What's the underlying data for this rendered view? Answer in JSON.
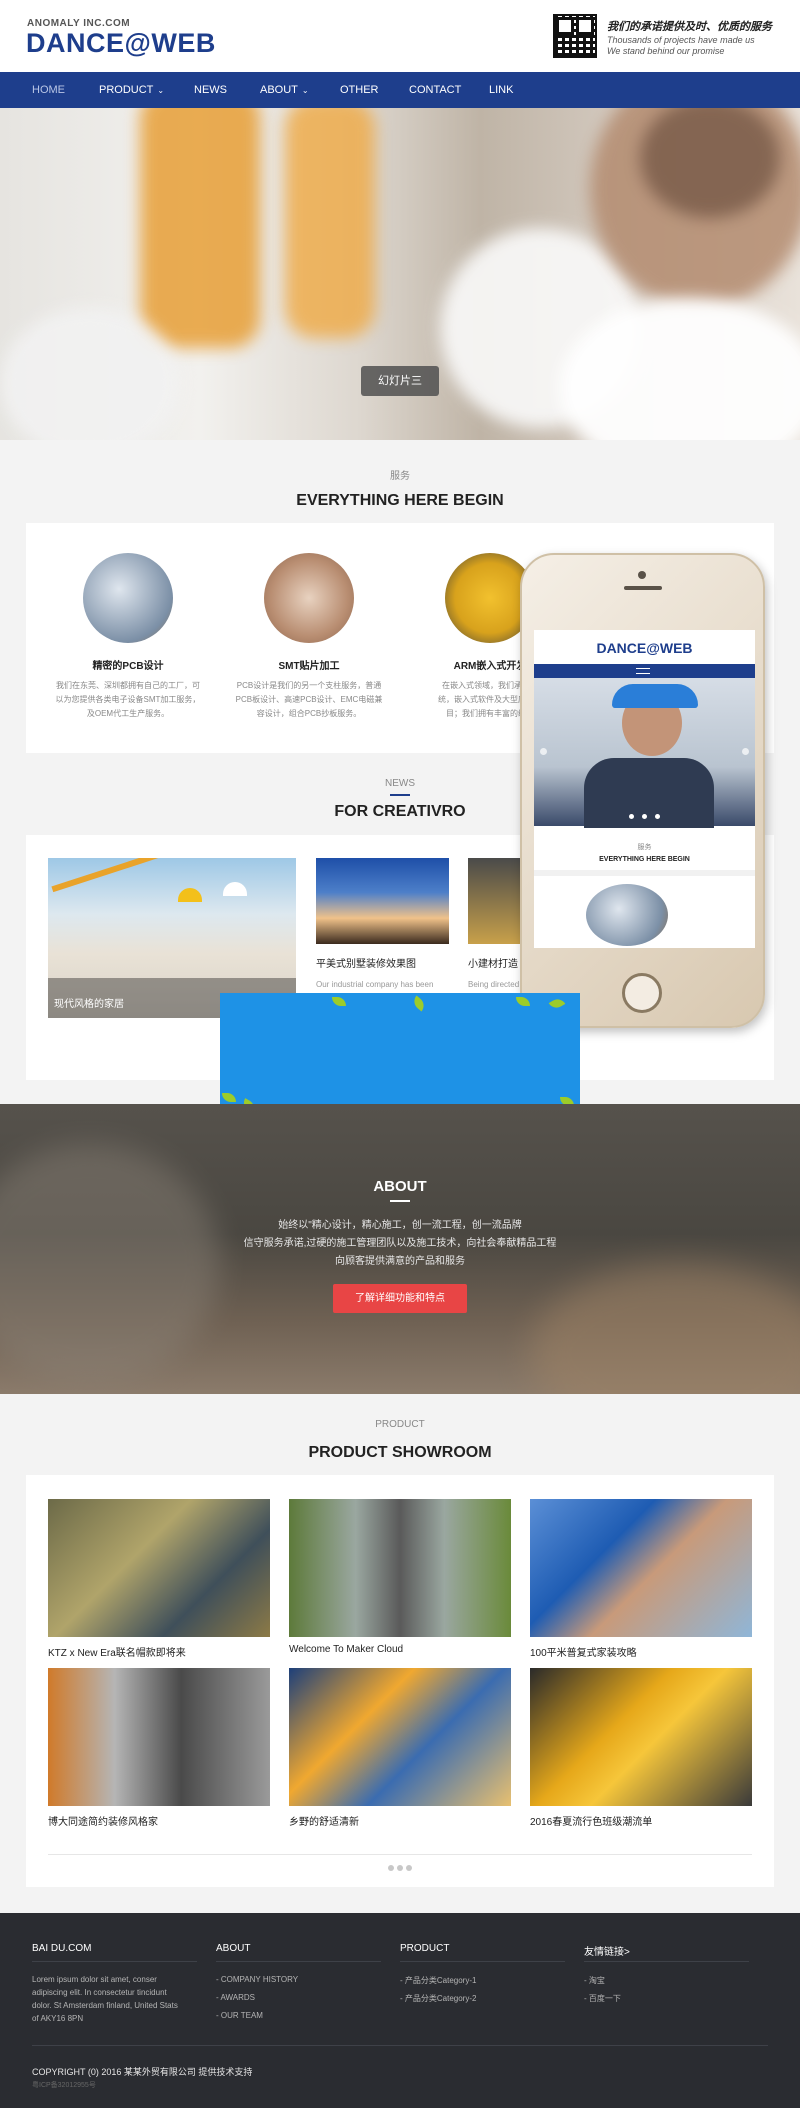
{
  "header": {
    "logo_small": "ANOMALY INC.COM",
    "logo_big": "DANCE@WEB",
    "slogan_main": "我们的承诺提供及时、优质的服务",
    "slogan_sub_1": "Thousands of projects have made us",
    "slogan_sub_2": "We stand behind our promise"
  },
  "nav": {
    "items": [
      {
        "label": "HOME"
      },
      {
        "label": "PRODUCT"
      },
      {
        "label": "NEWS"
      },
      {
        "label": "ABOUT"
      },
      {
        "label": "OTHER"
      },
      {
        "label": "CONTACT"
      },
      {
        "label": "LINK"
      }
    ]
  },
  "hero": {
    "button": "幻灯片三"
  },
  "services": {
    "small": "服务",
    "title": "EVERYTHING HERE BEGIN",
    "items": [
      {
        "title": "精密的PCB设计",
        "desc_1": "我们在东莞、深圳都拥有自己的工厂，可",
        "desc_2": "以为您提供各类电子设备SMT加工服务，",
        "desc_3": "及OEM代工生产服务。"
      },
      {
        "title": "SMT贴片加工",
        "desc_1": "PCB设计是我们的另一个支柱服务，普通",
        "desc_2": "PCB板设计、高速PCB设计、EMC电磁兼",
        "desc_3": "容设计，组合PCB抄板服务。"
      },
      {
        "title": "ARM嵌入式开发",
        "desc_1": "在嵌入式领域，我们承接各",
        "desc_2": "统，嵌入式软件及大型应用系",
        "desc_3": "目；我们拥有丰富的经验"
      }
    ]
  },
  "phone": {
    "logo": "DANCE@WEB",
    "section_small": "服务",
    "section_title": "EVERYTHING HERE BEGIN"
  },
  "news": {
    "small": "NEWS",
    "title": "FOR CREATIVRO",
    "items": [
      {
        "caption": "现代风格的家居",
        "desc": ""
      },
      {
        "caption": "平美式别墅装修效果图",
        "desc": "Our industrial company has been"
      },
      {
        "caption": "小建材打造",
        "desc": "Being directed"
      }
    ]
  },
  "about": {
    "title": "ABOUT",
    "line_1": "始终以\"精心设计，精心施工，创一流工程，创一流品牌",
    "line_2": "信守服务承诺,过硬的施工管理团队以及施工技术，向社会奉献精品工程",
    "line_3": "向顾客提供满意的产品和服务",
    "button": "了解详细功能和特点"
  },
  "products": {
    "small": "PRODUCT",
    "title": "PRODUCT SHOWROOM",
    "items": [
      {
        "caption": "KTZ x New Era联名帽款即将来"
      },
      {
        "caption": "Welcome To Maker Cloud"
      },
      {
        "caption": "100平米普复式家装攻略"
      },
      {
        "caption": "博大同途简约装修风格家"
      },
      {
        "caption": "乡野的舒适清新"
      },
      {
        "caption": "2016春夏流行色班级潮流单"
      }
    ]
  },
  "footer": {
    "col1": {
      "title": "BAI DU.COM",
      "text": "Lorem ipsum dolor sit amet, conser adipiscing elit. In consectetur tincidunt dolor. St Amsterdam finland, United Stats of AKY16 8PN"
    },
    "col2": {
      "title": "ABOUT",
      "items": [
        "- COMPANY HISTORY",
        "- AWARDS",
        "- OUR TEAM"
      ]
    },
    "col3": {
      "title": "PRODUCT",
      "items": [
        "- 产品分类Category-1",
        "- 产品分类Category-2"
      ]
    },
    "col4": {
      "title": "友情链接>",
      "items": [
        "- 淘宝",
        "- 百度一下"
      ]
    },
    "copyright": "COPYRIGHT (0) 2016 某某外贸有限公司 提供技术支持",
    "icp": "粤ICP备32012955号"
  },
  "colors": {
    "brand": "#1e3e8c",
    "accent_red": "#e84545",
    "footer_bg": "#2a2c31"
  }
}
